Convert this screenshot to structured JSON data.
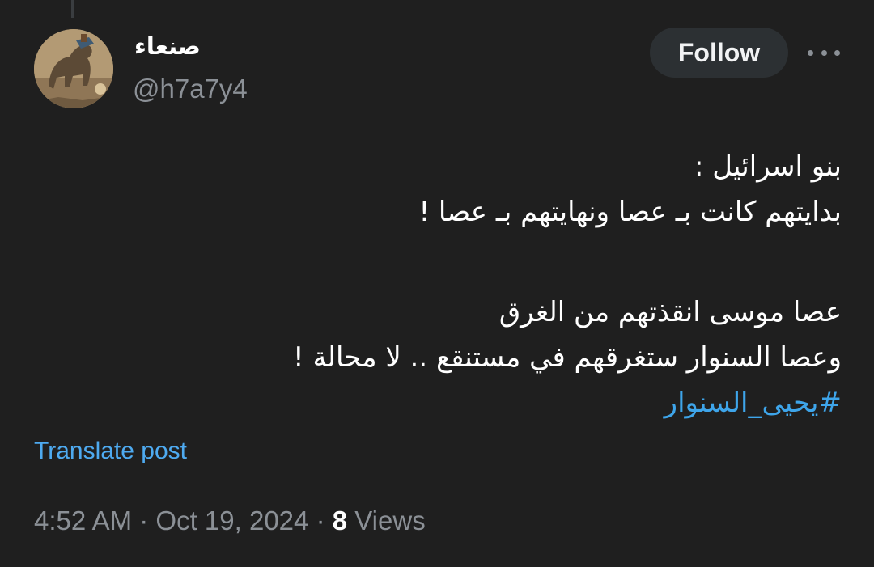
{
  "author": {
    "display_name": "صنعاء",
    "handle": "@h7a7y4"
  },
  "header": {
    "follow_label": "Follow",
    "more_icon": "more-horizontal-icon"
  },
  "post": {
    "lines": [
      "بنو اسرائيل :",
      "بدايتهم كانت بـ عصا ونهايتهم بـ عصا !",
      "عصا موسى انقذتهم من الغرق",
      "وعصا السنوار ستغرقهم في مستنقع .. لا محالة !"
    ],
    "hashtag": "#يحيى_السنوار"
  },
  "translate_label": "Translate post",
  "meta": {
    "time": "4:52 AM",
    "separator": "·",
    "date": "Oct 19, 2024",
    "views_count": "8",
    "views_label": "Views"
  },
  "colors": {
    "background": "#1f1f1f",
    "link": "#3ea5ea",
    "secondary_text": "#8b9096",
    "follow_button_bg": "#2c3033"
  }
}
